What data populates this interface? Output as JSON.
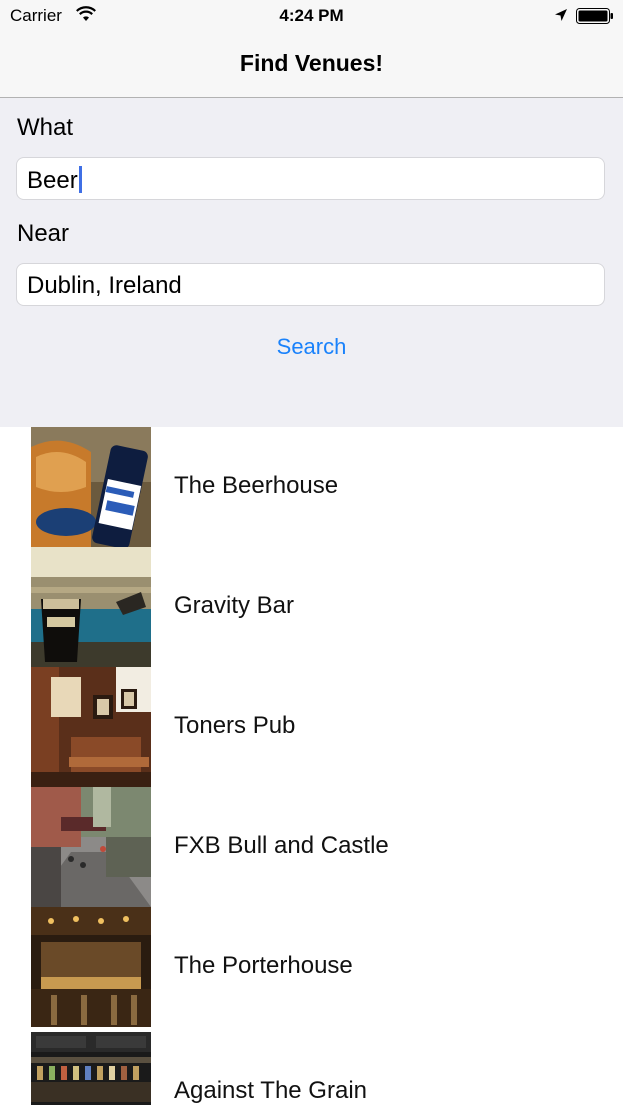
{
  "status_bar": {
    "carrier": "Carrier",
    "time": "4:24 PM",
    "icons": [
      "wifi-icon",
      "location-arrow-icon",
      "battery-icon"
    ]
  },
  "nav": {
    "title": "Find Venues!"
  },
  "form": {
    "what_label": "What",
    "what_value": "Beer",
    "near_label": "Near",
    "near_value": "Dublin, Ireland",
    "search_label": "Search"
  },
  "colors": {
    "accent": "#1a82fb",
    "caret": "#3f6fe5",
    "form_background": "#efeff4",
    "bar_background": "#f7f7f7"
  },
  "venues": [
    {
      "name": "The Beerhouse"
    },
    {
      "name": "Gravity Bar"
    },
    {
      "name": "Toners Pub"
    },
    {
      "name": "FXB Bull and Castle"
    },
    {
      "name": "The Porterhouse"
    },
    {
      "name": "Against The Grain"
    }
  ]
}
